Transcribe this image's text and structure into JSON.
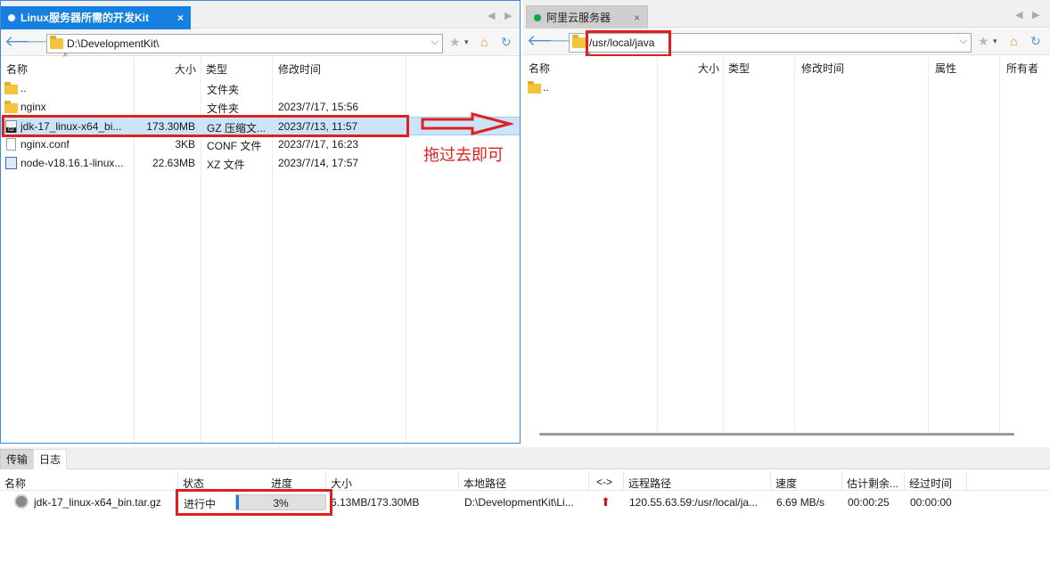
{
  "left_panel": {
    "tab_title": "Linux服务器所需的开发Kit",
    "tab_close": "×",
    "path": "D:\\DevelopmentKit\\",
    "columns": {
      "name": "名称",
      "size": "大小",
      "type": "类型",
      "modified": "修改时间"
    },
    "rows": [
      {
        "icon": "folder-icon",
        "name": "..",
        "size": "",
        "type": "文件夹",
        "modified": ""
      },
      {
        "icon": "folder-icon",
        "name": "nginx",
        "size": "",
        "type": "文件夹",
        "modified": "2023/7/17, 15:56"
      },
      {
        "icon": "gz-archive-icon",
        "name": "jdk-17_linux-x64_bi...",
        "size": "173.30MB",
        "type": "GZ 压缩文...",
        "modified": "2023/7/13, 11:57"
      },
      {
        "icon": "file-icon",
        "name": "nginx.conf",
        "size": "3KB",
        "type": "CONF 文件",
        "modified": "2023/7/17, 16:23"
      },
      {
        "icon": "xz-archive-icon",
        "name": "node-v18.16.1-linux...",
        "size": "22.63MB",
        "type": "XZ 文件",
        "modified": "2023/7/14, 17:57"
      }
    ]
  },
  "annotation": {
    "hint": "拖过去即可"
  },
  "right_panel": {
    "tab_title": "阿里云服务器",
    "tab_close": "×",
    "path": "/usr/local/java",
    "columns": {
      "name": "名称",
      "size": "大小",
      "type": "类型",
      "modified": "修改时间",
      "attributes": "属性",
      "owner": "所有者"
    },
    "rows": [
      {
        "icon": "folder-icon",
        "name": ".."
      }
    ]
  },
  "transfer_panel": {
    "tabs": {
      "transfer": "传输",
      "log": "日志"
    },
    "columns": {
      "name": "名称",
      "status": "状态",
      "progress": "进度",
      "size": "大小",
      "local_path": "本地路径",
      "direction": "<->",
      "remote_path": "远程路径",
      "speed": "速度",
      "eta": "估计剩余...",
      "elapsed": "经过时间"
    },
    "rows": [
      {
        "name": "jdk-17_linux-x64_bin.tar.gz",
        "status": "进行中",
        "progress_text": "3%",
        "progress_fraction": 0.03,
        "size": "6.13MB/173.30MB",
        "local_path": "D:\\DevelopmentKit\\Li...",
        "direction_icon": "upload-arrow-icon",
        "remote_path": "120.55.63.59:/usr/local/ja...",
        "speed": "6.69 MB/s",
        "eta": "00:00:25",
        "elapsed": "00:00:00"
      }
    ]
  },
  "colors": {
    "accent": "#1680e0",
    "highlight_red": "#e02020",
    "selection": "#cce4f7",
    "online_dot": "#11a84a"
  }
}
